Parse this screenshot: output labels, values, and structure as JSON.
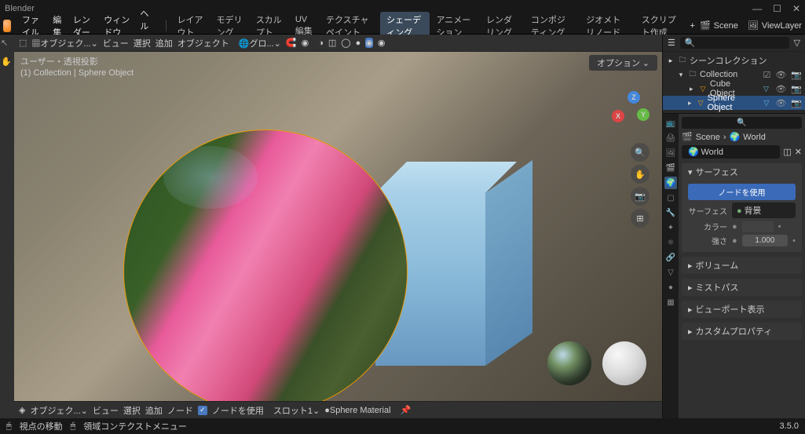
{
  "app_title": "Blender",
  "menu": {
    "file": "ファイル",
    "edit": "編集",
    "render": "レンダー",
    "window": "ウィンドウ",
    "help": "ヘルプ"
  },
  "workspaces": [
    "レイアウト",
    "モデリング",
    "スカルプト",
    "UV編集",
    "テクスチャペイント",
    "シェーディング",
    "アニメーション",
    "レンダリング",
    "コンポジティング",
    "ジオメトリノード",
    "スクリプト作成"
  ],
  "active_workspace": "シェーディング",
  "scene_label": "Scene",
  "viewlayer_label": "ViewLayer",
  "tb": {
    "object": "オブジェク...",
    "view": "ビュー",
    "select": "選択",
    "add": "追加",
    "obj2": "オブジェクト",
    "global": "グロ...",
    "options": "オプション"
  },
  "vp_info_line1": "ユーザー・透視投影",
  "vp_info_line2": "(1) Collection | Sphere Object",
  "outliner": {
    "scene": "シーンコレクション",
    "collection": "Collection",
    "cube": "Cube Object",
    "sphere": "Sphere Object",
    "search_placeholder": ""
  },
  "props": {
    "search_placeholder": "",
    "crumb_scene": "Scene",
    "crumb_world": "World",
    "world_pin": "World",
    "surface": "サーフェス",
    "use_nodes": "ノードを使用",
    "surface_label": "サーフェス",
    "surface_value": "背景",
    "color_label": "カラー",
    "strength_label": "強さ",
    "strength_value": "1.000",
    "volume": "ボリューム",
    "mist": "ミストパス",
    "viewport": "ビューポート表示",
    "custom": "カスタムプロパティ"
  },
  "footer": {
    "object": "オブジェク...",
    "view": "ビュー",
    "select": "選択",
    "add": "追加",
    "node": "ノード",
    "use_nodes": "ノードを使用",
    "slot": "スロット1",
    "material": "Sphere Material"
  },
  "status": {
    "move": "視点の移動",
    "ctx": "領域コンテクストメニュー",
    "version": "3.5.0"
  }
}
